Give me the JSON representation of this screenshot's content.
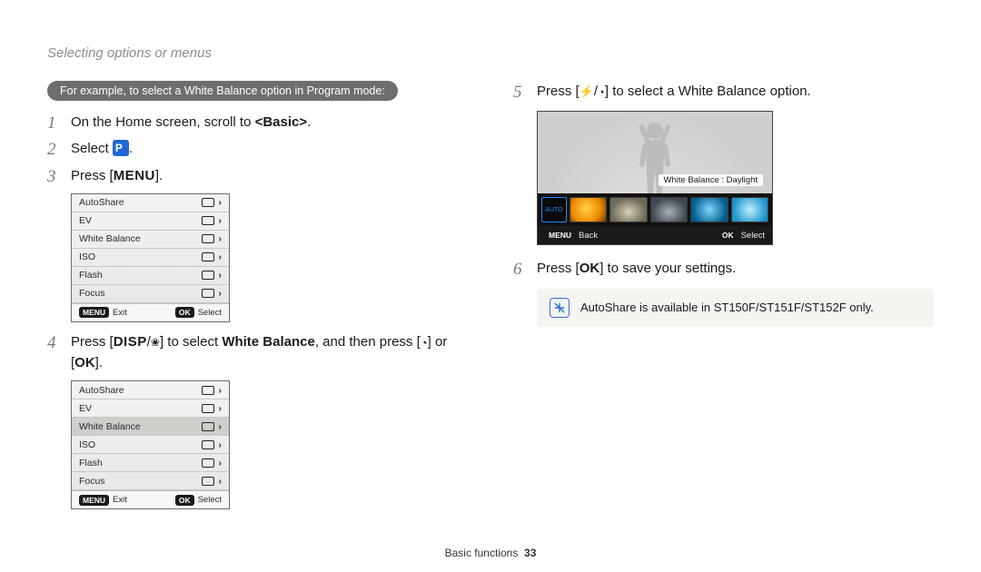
{
  "header": {
    "title": "Selecting options or menus"
  },
  "pill": "For example, to select a White Balance option in Program mode:",
  "left": {
    "steps": [
      {
        "n": "1",
        "pre": "On the Home screen, scroll to ",
        "bold": "<Basic>",
        "post": "."
      },
      {
        "n": "2",
        "pre": "Select ",
        "iconName": "program-mode-icon",
        "post": "."
      },
      {
        "n": "3",
        "pre": "Press [",
        "btn": "MENU",
        "post": "]."
      },
      {
        "menuRef": "menu1"
      },
      {
        "n": "4",
        "pre": "Press [",
        "btn": "DISP",
        "mid1": "/",
        "iconName": "macro-icon",
        "mid2": "] to select ",
        "bold": "White Balance",
        "post2": ", and then press [",
        "iconName2": "timer-icon",
        "post3": "] or [",
        "btn2": "OK",
        "post4": "]."
      },
      {
        "menuRef": "menu2"
      }
    ]
  },
  "right": {
    "steps": [
      {
        "n": "5",
        "pre": "Press [",
        "iconName": "flash-icon",
        "mid1": "/",
        "iconName2": "timer-icon",
        "post": "] to select a White Balance option."
      },
      {
        "shotRef": true
      },
      {
        "n": "6",
        "pre": "Press [",
        "btn": "OK",
        "post": "] to save your settings."
      }
    ],
    "note": "AutoShare is available in ST150F/ST151F/ST152F only."
  },
  "menu": {
    "items": [
      "AutoShare",
      "EV",
      "White Balance",
      "ISO",
      "Flash",
      "Focus"
    ],
    "highlight_index_menu2": 2,
    "footer": {
      "left_label": "Exit",
      "left_btn": "MENU",
      "right_label": "Select",
      "right_btn": "OK"
    }
  },
  "shot": {
    "tag": "White Balance : Daylight",
    "auto_label": "AUTO",
    "footer": {
      "left_label": "Back",
      "left_btn": "MENU",
      "right_label": "Select",
      "right_btn": "OK"
    }
  },
  "page_footer": {
    "section": "Basic functions",
    "page": "33"
  }
}
